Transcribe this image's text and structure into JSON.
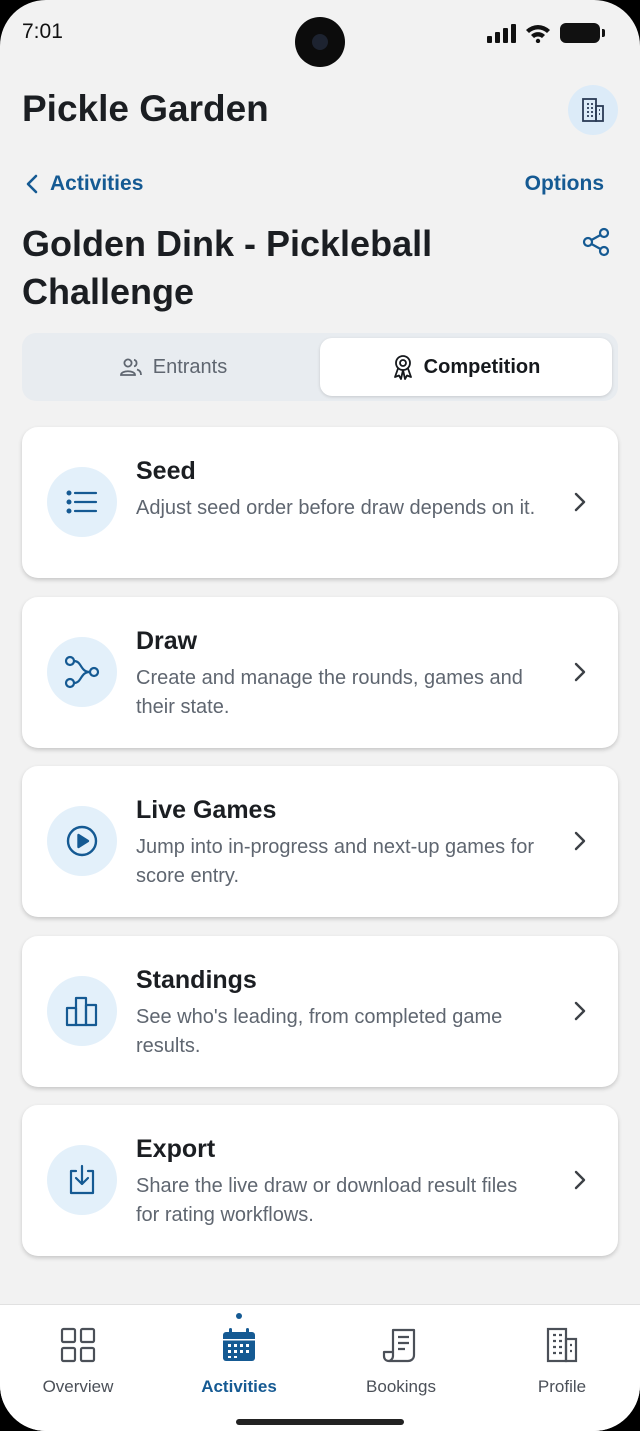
{
  "status_bar": {
    "time": "7:01"
  },
  "header": {
    "app_title": "Pickle Garden",
    "org_icon": "building-icon"
  },
  "nav_row": {
    "back_label": "Activities",
    "options_label": "Options"
  },
  "page": {
    "title": "Golden Dink - Pickleball Challenge",
    "share_icon": "share-icon"
  },
  "tabs": [
    {
      "label": "Entrants",
      "icon": "users-icon",
      "active": false
    },
    {
      "label": "Competition",
      "icon": "award-icon",
      "active": true
    }
  ],
  "cards": [
    {
      "title": "Seed",
      "description": "Adjust seed order before draw depends on it.",
      "icon": "list-icon"
    },
    {
      "title": "Draw",
      "description": "Create and manage the rounds, games and their state.",
      "icon": "bracket-icon"
    },
    {
      "title": "Live Games",
      "description": "Jump into in-progress and next-up games for score entry.",
      "icon": "play-icon"
    },
    {
      "title": "Standings",
      "description": "See who's leading, from completed game results.",
      "icon": "bar-chart-icon"
    },
    {
      "title": "Export",
      "description": "Share the live draw or download result files for rating workflows.",
      "icon": "download-icon"
    }
  ],
  "bottom_nav": [
    {
      "label": "Overview",
      "icon": "grid-icon",
      "active": false
    },
    {
      "label": "Activities",
      "icon": "calendar-icon",
      "active": true
    },
    {
      "label": "Bookings",
      "icon": "receipt-icon",
      "active": false
    },
    {
      "label": "Profile",
      "icon": "building-icon",
      "active": false
    }
  ],
  "colors": {
    "accent": "#155a93",
    "accent_bg": "#e3f0fa",
    "background": "#f2f2f2"
  }
}
